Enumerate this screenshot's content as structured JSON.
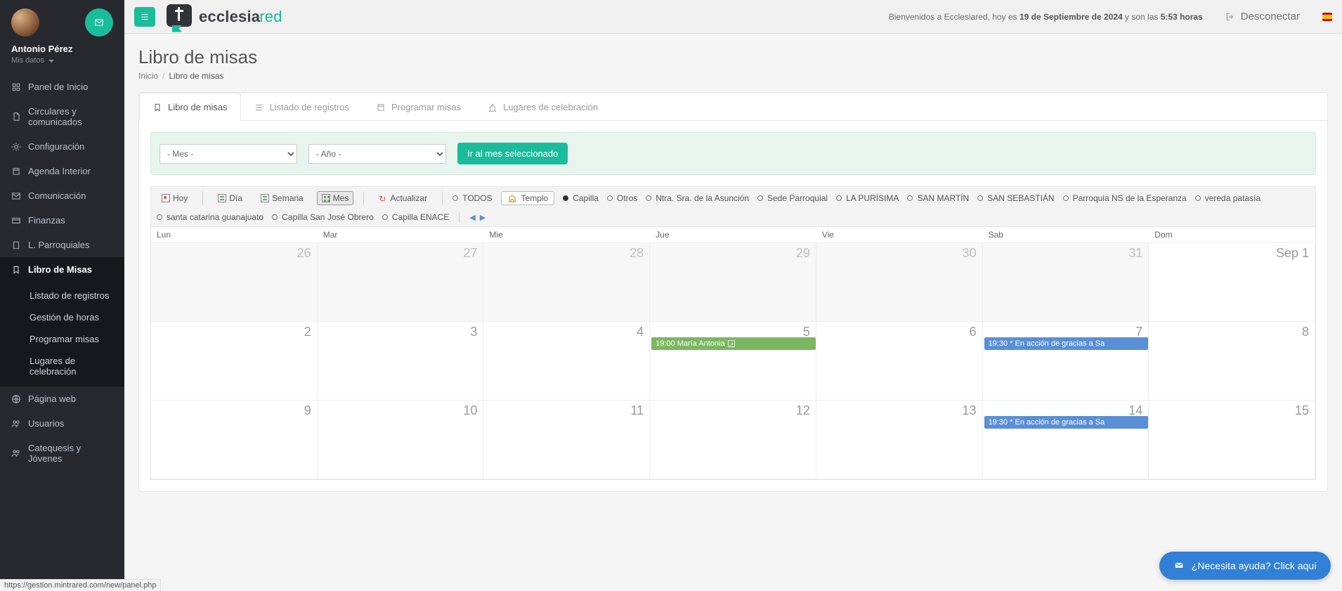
{
  "user": {
    "name": "Antonio Pérez",
    "data_label": "Mis datos"
  },
  "top": {
    "welcome_pre": "Bienvenidos a Ecclesiared, hoy es ",
    "welcome_date": "19 de Septiembre de 2024",
    "welcome_mid": " y son las ",
    "welcome_time": "5:53 horas",
    "logout": "Desconectar"
  },
  "brand": {
    "a": "ecclesia",
    "b": "red"
  },
  "sidebar": [
    {
      "label": "Panel de Inicio",
      "icon": "grid"
    },
    {
      "label": "Circulares y comunicados",
      "icon": "doc"
    },
    {
      "label": "Configuración",
      "icon": "gear"
    },
    {
      "label": "Agenda Interior",
      "icon": "cal"
    },
    {
      "label": "Comunicación",
      "icon": "mail"
    },
    {
      "label": "Finanzas",
      "icon": "card"
    },
    {
      "label": "L. Parroquiales",
      "icon": "book"
    },
    {
      "label": "Libro de Misas",
      "icon": "bookmark",
      "active": true
    },
    {
      "label": "Página web",
      "icon": "globe"
    },
    {
      "label": "Usuarios",
      "icon": "users"
    },
    {
      "label": "Catequesis y Jóvenes",
      "icon": "users"
    }
  ],
  "sidebar_sub": [
    "Listado de registros",
    "Gestión de horas",
    "Programar misas",
    "Lugares de celebración"
  ],
  "page": {
    "title": "Libro de misas",
    "bc_home": "Inicio",
    "bc_sep": "/",
    "bc_current": "Libro de misas"
  },
  "tabs": [
    {
      "label": "Libro de misas",
      "active": true,
      "icon": "bookmark"
    },
    {
      "label": "Listado de registros",
      "icon": "list"
    },
    {
      "label": "Programar misas",
      "icon": "cal"
    },
    {
      "label": "Lugares de celebración",
      "icon": "church"
    }
  ],
  "selectbar": {
    "month_placeholder": "- Mes -",
    "year_placeholder": "- Año -",
    "go": "Ir al mes seleccionado"
  },
  "toolbar": {
    "today": "Hoy",
    "day": "Día",
    "week": "Semana",
    "month": "Mes",
    "refresh": "Actualizar",
    "all": "TODOS",
    "temple": "Templo"
  },
  "filters": [
    "Capilla",
    "Otros",
    "Ntra. Sra. de la Asunción",
    "Sede Parroquial",
    "LA PURÍSIMA",
    "SAN MARTÍN",
    "SAN SEBASTIÁN",
    "Parroquia NS de la Esperanza",
    "vereda patasía",
    "santa catarina guanajuato",
    "Capilla San José Obrero",
    "Capilla ENACE"
  ],
  "arrows": {
    "prev": "◀",
    "next": "▶"
  },
  "dow": [
    "Lun",
    "Mar",
    "Mie",
    "Jue",
    "Vie",
    "Sab",
    "Dom"
  ],
  "weeks": [
    [
      {
        "n": "26",
        "dim": true
      },
      {
        "n": "27",
        "dim": true
      },
      {
        "n": "28",
        "dim": true
      },
      {
        "n": "29",
        "dim": true
      },
      {
        "n": "30",
        "dim": true
      },
      {
        "n": "31",
        "dim": true
      },
      {
        "n": "Sep 1"
      }
    ],
    [
      {
        "n": "2"
      },
      {
        "n": "3"
      },
      {
        "n": "4"
      },
      {
        "n": "5",
        "ev": {
          "cls": "green",
          "text": "19:00 María Antonia",
          "ext": true
        }
      },
      {
        "n": "6"
      },
      {
        "n": "7",
        "ev": {
          "cls": "blue",
          "text": "19:30 * En acción de gracias a Sa"
        }
      },
      {
        "n": "8"
      }
    ],
    [
      {
        "n": "9"
      },
      {
        "n": "10"
      },
      {
        "n": "11"
      },
      {
        "n": "12"
      },
      {
        "n": "13"
      },
      {
        "n": "14",
        "ev": {
          "cls": "blue",
          "text": "19:30 * En acción de gracias a Sa"
        }
      },
      {
        "n": "15"
      }
    ]
  ],
  "help": "¿Necesita ayuda? Click aquí",
  "status_url": "https://gestion.mintrared.com/new/panel.php"
}
